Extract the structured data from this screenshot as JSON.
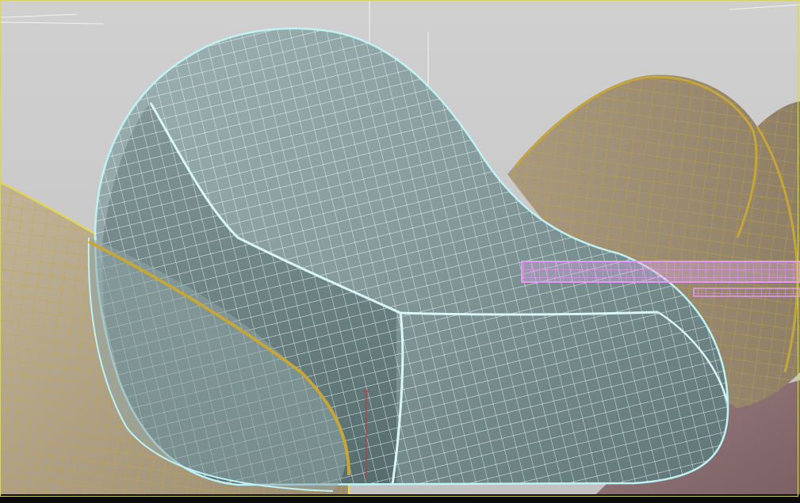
{
  "viewport": {
    "background_color": "#c8c8c8",
    "floor_color": "#8c6f72",
    "active_border_color": "#d6d36a"
  },
  "objects": [
    {
      "name": "armchair-shell",
      "state": "selected",
      "wireframe_color": "#ffffff",
      "selection_outline_color": "#bff2f5",
      "surface_color": "#8aa0a1"
    },
    {
      "name": "left-blob",
      "state": "unselected",
      "wireframe_color": "#c6a63a",
      "surface_color": "#b7a88a"
    },
    {
      "name": "right-blob",
      "state": "unselected",
      "wireframe_color": "#c6a63a",
      "surface_color": "#a59477"
    },
    {
      "name": "lattice-bar",
      "state": "frozen",
      "wireframe_color": "#e29bf1"
    }
  ]
}
